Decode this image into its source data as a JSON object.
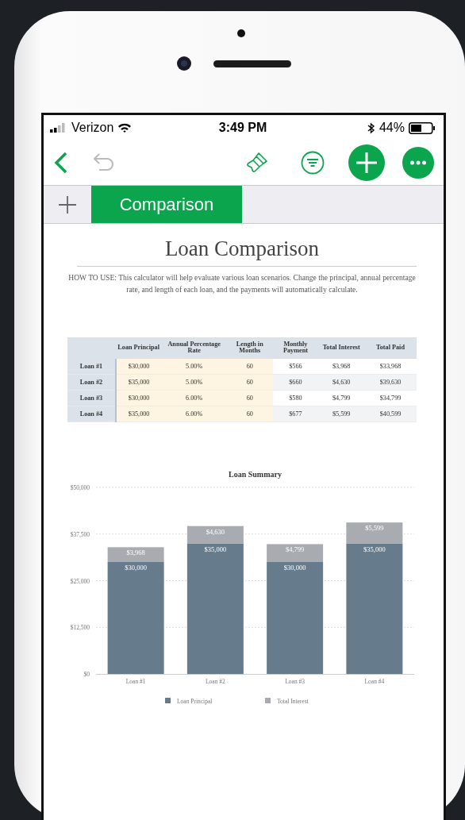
{
  "status_bar": {
    "carrier": "Verizon",
    "time": "3:49 PM",
    "battery": "44%"
  },
  "tabs": [
    {
      "label": "Comparison",
      "selected": true
    }
  ],
  "title": "Loan Comparison",
  "instructions": "HOW TO USE: This calculator will help evaluate various loan scenarios. Change the principal, annual percentage rate, and length of each loan, and the payments will automatically calculate.",
  "table": {
    "columns": [
      {
        "label": "Loan Principal",
        "kind": "input"
      },
      {
        "label": "Annual Percentage Rate",
        "kind": "input"
      },
      {
        "label": "Length in Months",
        "kind": "input"
      },
      {
        "label": "Monthly Payment",
        "kind": "output"
      },
      {
        "label": "Total Interest",
        "kind": "output"
      },
      {
        "label": "Total Paid",
        "kind": "output"
      }
    ],
    "rows": [
      {
        "label": "Loan #1",
        "cells": [
          "$30,000",
          "5.00%",
          "60",
          "$566",
          "$3,968",
          "$33,968"
        ]
      },
      {
        "label": "Loan #2",
        "cells": [
          "$35,000",
          "5.00%",
          "60",
          "$660",
          "$4,630",
          "$39,630"
        ]
      },
      {
        "label": "Loan #3",
        "cells": [
          "$30,000",
          "6.00%",
          "60",
          "$580",
          "$4,799",
          "$34,799"
        ]
      },
      {
        "label": "Loan #4",
        "cells": [
          "$35,000",
          "6.00%",
          "60",
          "$677",
          "$5,599",
          "$40,599"
        ]
      }
    ]
  },
  "chart_data": {
    "type": "bar",
    "title": "Loan Summary",
    "stacked": true,
    "categories": [
      "Loan #1",
      "Loan #2",
      "Loan #3",
      "Loan #4"
    ],
    "series": [
      {
        "name": "Loan Principal",
        "color": "#667b8c",
        "values": [
          30000,
          35000,
          30000,
          35000
        ]
      },
      {
        "name": "Total Interest",
        "color": "#a8acb1",
        "values": [
          3968,
          4630,
          4799,
          5599
        ]
      }
    ],
    "ylim": [
      0,
      50000
    ],
    "grid": true,
    "legend": "bottom",
    "yticks": [
      {
        "value": 0,
        "label": "$0"
      },
      {
        "value": 12500,
        "label": "$12,500"
      },
      {
        "value": 25000,
        "label": "$25,000"
      },
      {
        "value": 37500,
        "label": "$37,500"
      },
      {
        "value": 50000,
        "label": "$50,000"
      }
    ],
    "value_labels": [
      [
        "$30,000",
        "$35,000",
        "$30,000",
        "$35,000"
      ],
      [
        "$3,968",
        "$4,630",
        "$4,799",
        "$5,599"
      ]
    ]
  }
}
